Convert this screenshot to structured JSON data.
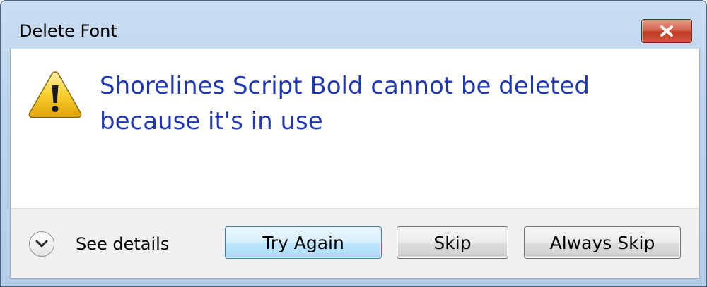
{
  "window": {
    "title": "Delete Font",
    "close_icon": "close-icon"
  },
  "content": {
    "icon": "warning-icon",
    "message": "Shorelines Script Bold cannot be deleted because it's in use"
  },
  "footer": {
    "details_icon": "chevron-down-icon",
    "details_label": "See details",
    "buttons": {
      "try_again": "Try Again",
      "skip": "Skip",
      "always_skip": "Always Skip"
    }
  },
  "colors": {
    "message_text": "#1f37b4",
    "close_button": "#c8573f",
    "default_button_border": "#3c7fb1"
  }
}
